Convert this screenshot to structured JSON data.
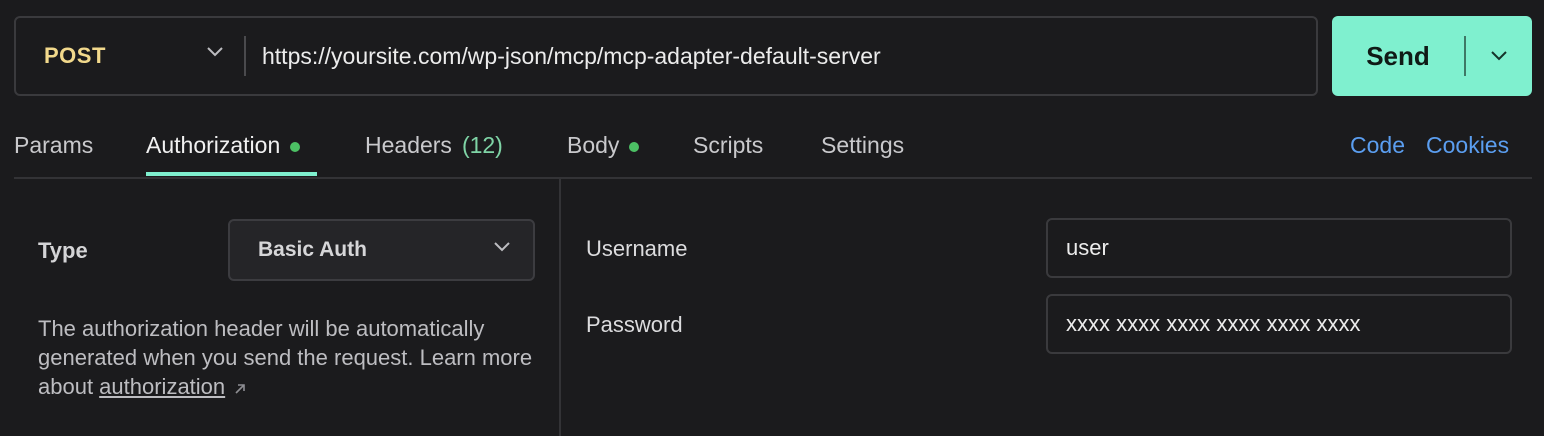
{
  "request": {
    "method": "POST",
    "url": "https://yoursite.com/wp-json/mcp/mcp-adapter-default-server",
    "send_label": "Send"
  },
  "tabs": {
    "params": "Params",
    "authorization": "Authorization",
    "headers": "Headers",
    "headers_count": "(12)",
    "body": "Body",
    "scripts": "Scripts",
    "settings": "Settings",
    "code": "Code",
    "cookies": "Cookies"
  },
  "auth": {
    "type_label": "Type",
    "type_value": "Basic Auth",
    "description": "The authorization header will be automatically generated when you send the request. Learn more about ",
    "link_text": "authorization",
    "username_label": "Username",
    "username_value": "user",
    "password_label": "Password",
    "password_value": "xxxx xxxx xxxx xxxx xxxx xxxx"
  },
  "colors": {
    "accent": "#7ff0cf",
    "method": "#f2d98c",
    "link": "#5b9ef0",
    "status_dot": "#4cc064"
  }
}
